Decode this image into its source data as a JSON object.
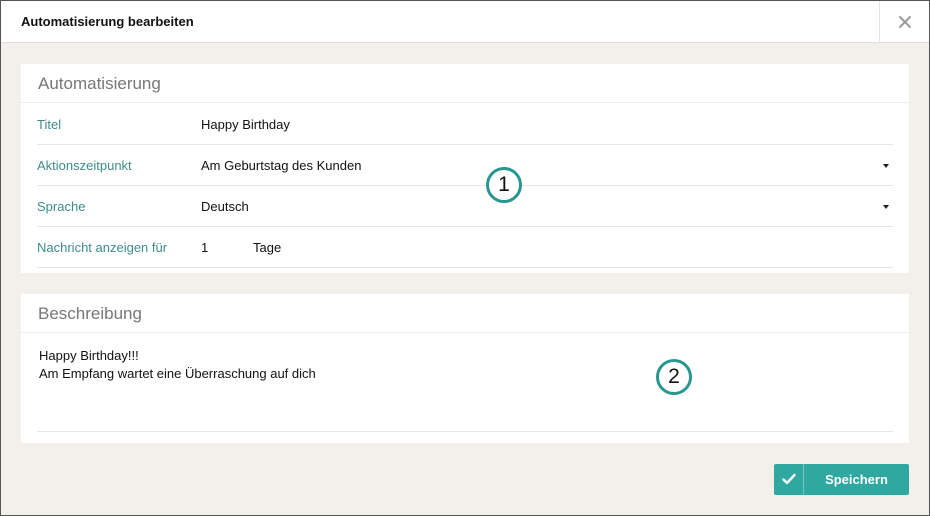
{
  "dialog": {
    "title": "Automatisierung bearbeiten"
  },
  "automation": {
    "heading": "Automatisierung",
    "rows": [
      {
        "label": "Titel",
        "value": "Happy Birthday"
      },
      {
        "label": "Aktionszeitpunkt",
        "value": "Am Geburtstag des Kunden"
      },
      {
        "label": "Sprache",
        "value": "Deutsch"
      },
      {
        "label": "Nachricht anzeigen für",
        "value": "1",
        "unit": "Tage"
      }
    ]
  },
  "description": {
    "heading": "Beschreibung",
    "lines": [
      "Happy Birthday!!!",
      "Am Empfang wartet eine Überraschung auf dich"
    ]
  },
  "markers": [
    "1",
    "2"
  ],
  "footer": {
    "save_label": "Speichern"
  },
  "colors": {
    "accent": "#2ea8a0",
    "label": "#3d8c8c",
    "background": "#f3efeb"
  },
  "icons": {
    "close": "close-icon",
    "dropdown": "caret-down-icon",
    "save": "check-icon"
  }
}
